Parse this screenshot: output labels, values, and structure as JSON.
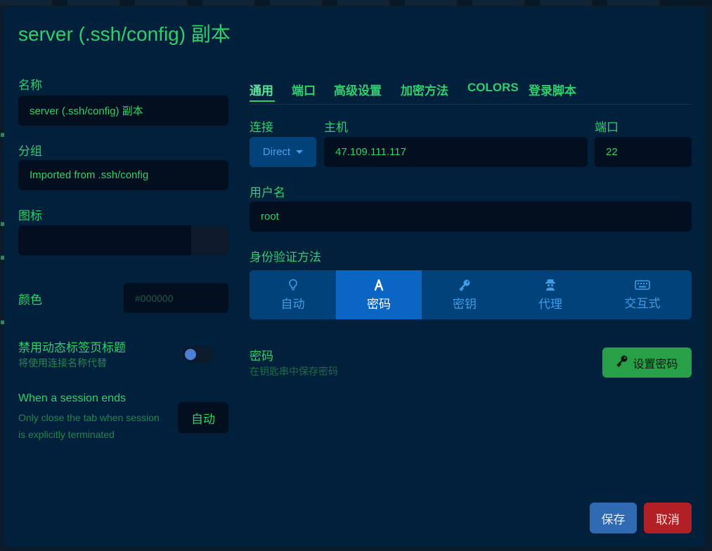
{
  "dialog": {
    "title": "server (.ssh/config) 副本"
  },
  "left": {
    "name_label": "名称",
    "name_value": "server (.ssh/config) 副本",
    "group_label": "分组",
    "group_value": "Imported from .ssh/config",
    "icon_label": "图标",
    "color_label": "颜色",
    "color_placeholder": "#000000",
    "disable_dynamic_title_label": "禁用动态标签页标题",
    "disable_dynamic_title_sub": "将使用连接名称代替",
    "disable_dynamic_title_enabled": false,
    "session_end_label": "When a session ends",
    "session_end_sub_1": "Only close the tab when session",
    "session_end_sub_2": "is explicitly terminated",
    "session_end_value": "自动"
  },
  "tabs": [
    {
      "label": "通用",
      "active": true
    },
    {
      "label": "端口",
      "active": false
    },
    {
      "label": "高级设置",
      "active": false
    },
    {
      "label": "加密方法",
      "active": false
    },
    {
      "label": "COLORS",
      "active": false
    },
    {
      "label": "登录脚本",
      "active": false
    }
  ],
  "general": {
    "connection_label": "连接",
    "connection_value": "Direct",
    "host_label": "主机",
    "host_value": "47.109.111.117",
    "port_label": "端口",
    "port_value": "22",
    "username_label": "用户名",
    "username_value": "root",
    "auth_method_label": "身份验证方法",
    "auth_methods": [
      {
        "label": "自动",
        "icon": "lightbulb-icon",
        "active": false
      },
      {
        "label": "密码",
        "icon": "font-icon",
        "active": true
      },
      {
        "label": "密钥",
        "icon": "key-icon",
        "active": false
      },
      {
        "label": "代理",
        "icon": "user-secret-icon",
        "active": false
      },
      {
        "label": "交互式",
        "icon": "keyboard-icon",
        "active": false
      }
    ],
    "password_label": "密码",
    "password_sub": "在钥匙串中保存密码",
    "set_password_label": "设置密码"
  },
  "footer": {
    "save_label": "保存",
    "cancel_label": "取消"
  },
  "colors": {
    "dialog_bg": "#01203c",
    "accent_green": "#2ed06b",
    "input_bg": "#010f1e",
    "segment_bg": "#02427a",
    "segment_active": "#0a66c2",
    "save_blue": "#2f6ab2",
    "cancel_red": "#b21f24",
    "set_password_green": "#27a047"
  }
}
